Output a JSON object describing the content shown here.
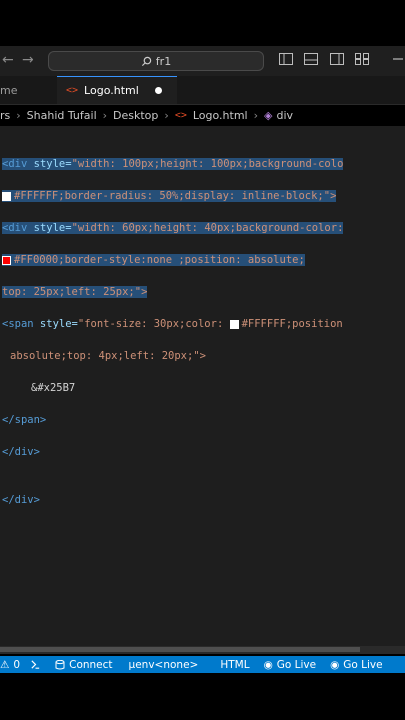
{
  "title_bar": {
    "search_text": "fr1",
    "back_arrow": "←",
    "forward_arrow": "→",
    "icons": [
      "toggle-primary-sidebar-icon",
      "toggle-panel-icon",
      "toggle-secondary-sidebar-icon",
      "customize-layout-icon"
    ]
  },
  "tabs": [
    {
      "label": "me"
    },
    {
      "label": "Logo.html",
      "file_icon": "<>",
      "modified": true
    }
  ],
  "breadcrumb": [
    "rs",
    "Shahid Tufail",
    "Desktop",
    "Logo.html",
    "div"
  ],
  "code_lines": [
    {
      "t1": "<div",
      "t2": " style=",
      "t3": "\"width: 100px;height: 100px;background-colo"
    },
    {
      "t1": "",
      "t2": "",
      "t3": "#FFFFFF;border-radius: 50%;display: inline-block;\">"
    },
    {
      "t1": "<div",
      "t2": " style=",
      "t3": "\"width: 60px;height: 40px;background-color:"
    },
    {
      "t1": "",
      "t2": "",
      "t3": "#FF0000;border-style:none ;position: absolute;"
    },
    {
      "t1": "",
      "t2": "",
      "t3": "top: 25px;left: 25px;\">"
    },
    {
      "t1": "<span",
      "t2": " style=",
      "t3": "\"font-size: 30px;color: "
    },
    {
      "t1": "",
      "t2": "",
      "t3": "absolute;top: 4px;left: 20px;\">"
    },
    {
      "t1": "",
      "t2": "",
      "t3": "&#x25B7"
    },
    {
      "t1": "</span>",
      "t2": "",
      "t3": ""
    },
    {
      "t1": "</div>",
      "t2": "",
      "t3": ""
    },
    {
      "t1": "",
      "t2": "",
      "t3": ""
    },
    {
      "t1": "</div>",
      "t2": "",
      "t3": ""
    }
  ],
  "line6_tail": "#FFFFFF;position",
  "status_bar": {
    "errors": "0",
    "connect": "Connect",
    "venv": "μenv<none>",
    "language": "HTML",
    "go_live_1": "Go Live",
    "go_live_2": "Go Live"
  },
  "colors": {
    "accent_blue": "#007acc",
    "selection": "#264f78",
    "swatch_white": "#FFFFFF",
    "swatch_red": "#FF0000"
  }
}
